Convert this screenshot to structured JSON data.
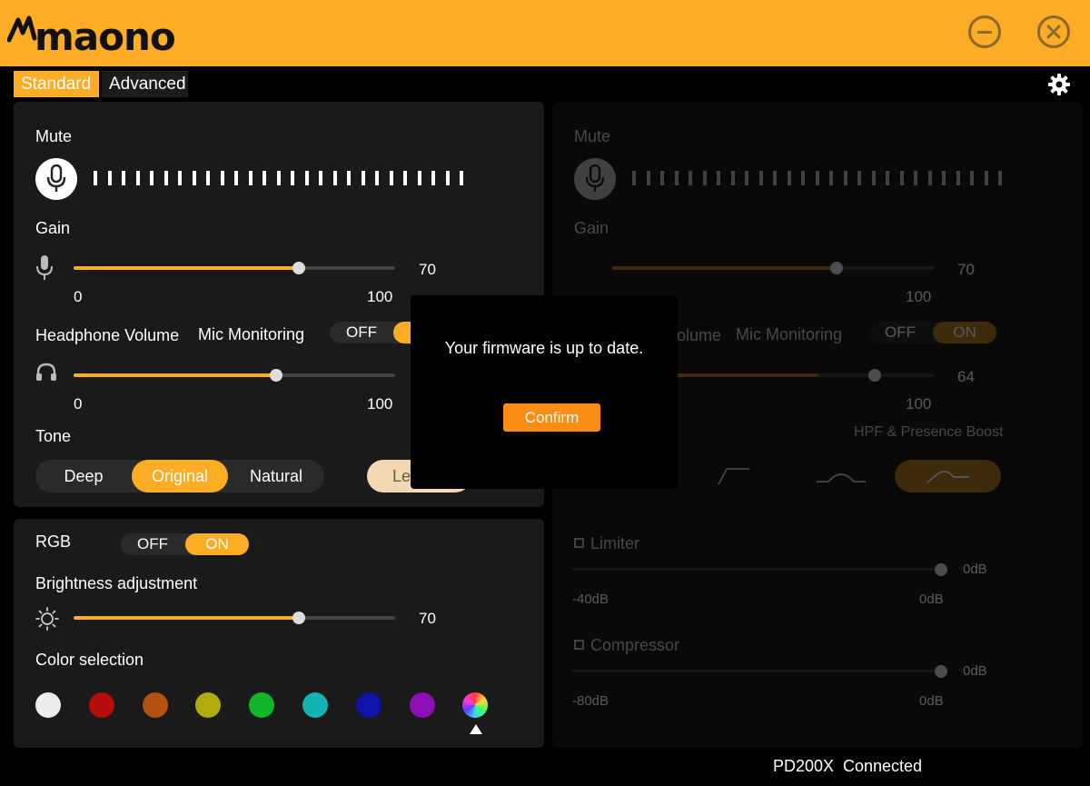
{
  "app": {
    "brand": "maono"
  },
  "tabs": {
    "standard": "Standard",
    "advanced": "Advanced"
  },
  "left": {
    "mute_label": "Mute",
    "gain": {
      "label": "Gain",
      "value": "70",
      "min": "0",
      "max": "100",
      "level": 0.7
    },
    "headphone": {
      "label": "Headphone Volume",
      "monitoring_label": "Mic Monitoring",
      "off": "OFF",
      "min": "0",
      "max": "100",
      "level": 0.63
    },
    "tone": {
      "label": "Tone",
      "options": [
        "Deep",
        "Original",
        "Natural"
      ],
      "selected": "Original",
      "level_pill": "Le"
    }
  },
  "rgb": {
    "label": "RGB",
    "off": "OFF",
    "on": "ON",
    "brightness": {
      "label": "Brightness adjustment",
      "value": "70",
      "level": 0.7
    },
    "color_label": "Color selection",
    "colors": [
      "#ececec",
      "#b80d0d",
      "#b5510f",
      "#b0aa0b",
      "#12b42c",
      "#13b3b3",
      "#0f13a8",
      "#8c0fb3",
      "rainbow"
    ]
  },
  "right": {
    "mute_label": "Mute",
    "gain": {
      "label": "Gain",
      "value": "70",
      "min": "0",
      "max": "100"
    },
    "headphone": {
      "label_partial": "olume",
      "monitoring_label": "Mic Monitoring",
      "off": "OFF",
      "on": "ON",
      "value": "64",
      "max": "100"
    },
    "hpf_label": "HPF & Presence Boost",
    "limiter": {
      "label": "Limiter",
      "value": "0dB",
      "min": "-40dB",
      "max": "0dB"
    },
    "compressor": {
      "label": "Compressor",
      "value": "0dB",
      "min": "-80dB",
      "max": "0dB"
    }
  },
  "modal": {
    "message": "Your firmware is up to date.",
    "confirm": "Confirm"
  },
  "status": {
    "device": "PD200X",
    "state": "Connected"
  },
  "colors": {
    "accent": "#FCAC25",
    "confirm": "#FB8C15",
    "panel": "#1a1a1a"
  }
}
